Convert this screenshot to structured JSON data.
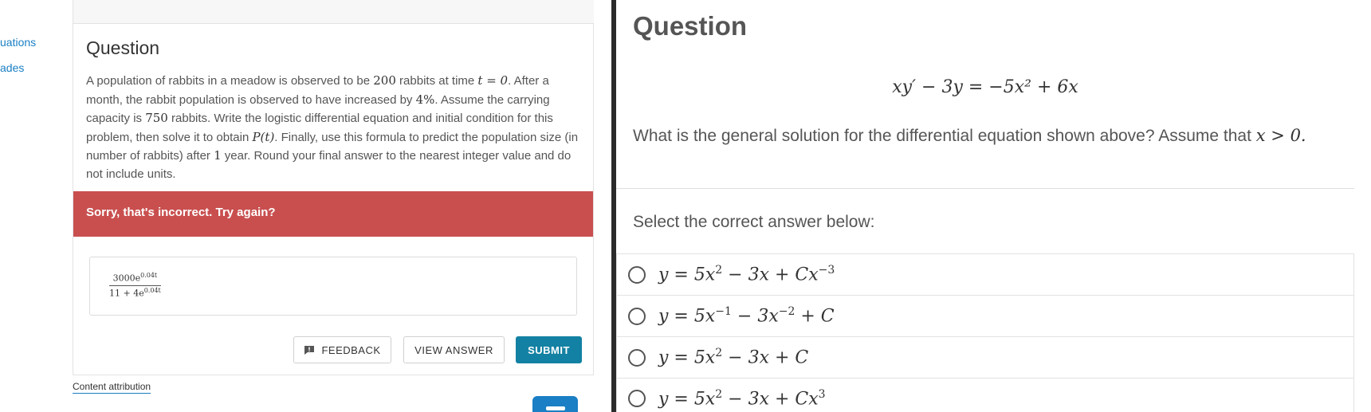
{
  "left_nav": {
    "items": [
      {
        "label": "uations"
      },
      {
        "label": "ades"
      }
    ]
  },
  "question_card": {
    "heading": "Question",
    "text_part1": "A population of rabbits in a meadow is observed to be ",
    "m_200": "200",
    "text_part2": " rabbits at time ",
    "m_t0": "t = 0",
    "text_part3": ". After a month, the rabbit population is observed to have increased by ",
    "m_4pct": "4%",
    "text_part4": ". Assume the carrying capacity is ",
    "m_750": "750",
    "text_part5": " rabbits. Write the logistic differential equation and initial condition for this problem, then solve it to obtain ",
    "m_Pt": "P(t)",
    "text_part6": ". Finally, use this formula to predict the population size (in number of rabbits) after ",
    "m_1": "1",
    "text_part7": " year. Round your final answer to the nearest integer value and do not include units.",
    "alert": "Sorry, that's incorrect. Try again?",
    "answer": {
      "num_base": "3000e",
      "num_exp": "0.04t",
      "den_base": "11 + 4e",
      "den_exp": "0.04t"
    },
    "buttons": {
      "feedback": "FEEDBACK",
      "view_answer": "VIEW ANSWER",
      "submit": "SUBMIT"
    },
    "attribution": "Content attribution"
  },
  "right_panel": {
    "heading": "Question",
    "equation": "xy′ − 3y = −5x² + 6x",
    "question_text": "What is the general solution for the differential equation shown above? Assume that ",
    "question_math": "x > 0.",
    "select_label": "Select the correct answer below:",
    "options": [
      {
        "base": "y = 5x",
        "e1": "2",
        "mid": " − 3x + Cx",
        "e2": "−3",
        "tail": ""
      },
      {
        "base": "y = 5x",
        "e1": "−1",
        "mid": " − 3x",
        "e2": "−2",
        "tail": " + C"
      },
      {
        "base": "y = 5x",
        "e1": "2",
        "mid": " − 3x + C",
        "e2": "",
        "tail": ""
      },
      {
        "base": "y = 5x",
        "e1": "2",
        "mid": " − 3x + Cx",
        "e2": "3",
        "tail": ""
      }
    ]
  },
  "colors": {
    "alert_bg": "#c94f4f",
    "submit_bg": "#1381a3",
    "link": "#1a7fc4",
    "divider": "#2b2b2b"
  },
  "icons": {
    "feedback": "feedback-icon",
    "chat": "chat-icon"
  }
}
